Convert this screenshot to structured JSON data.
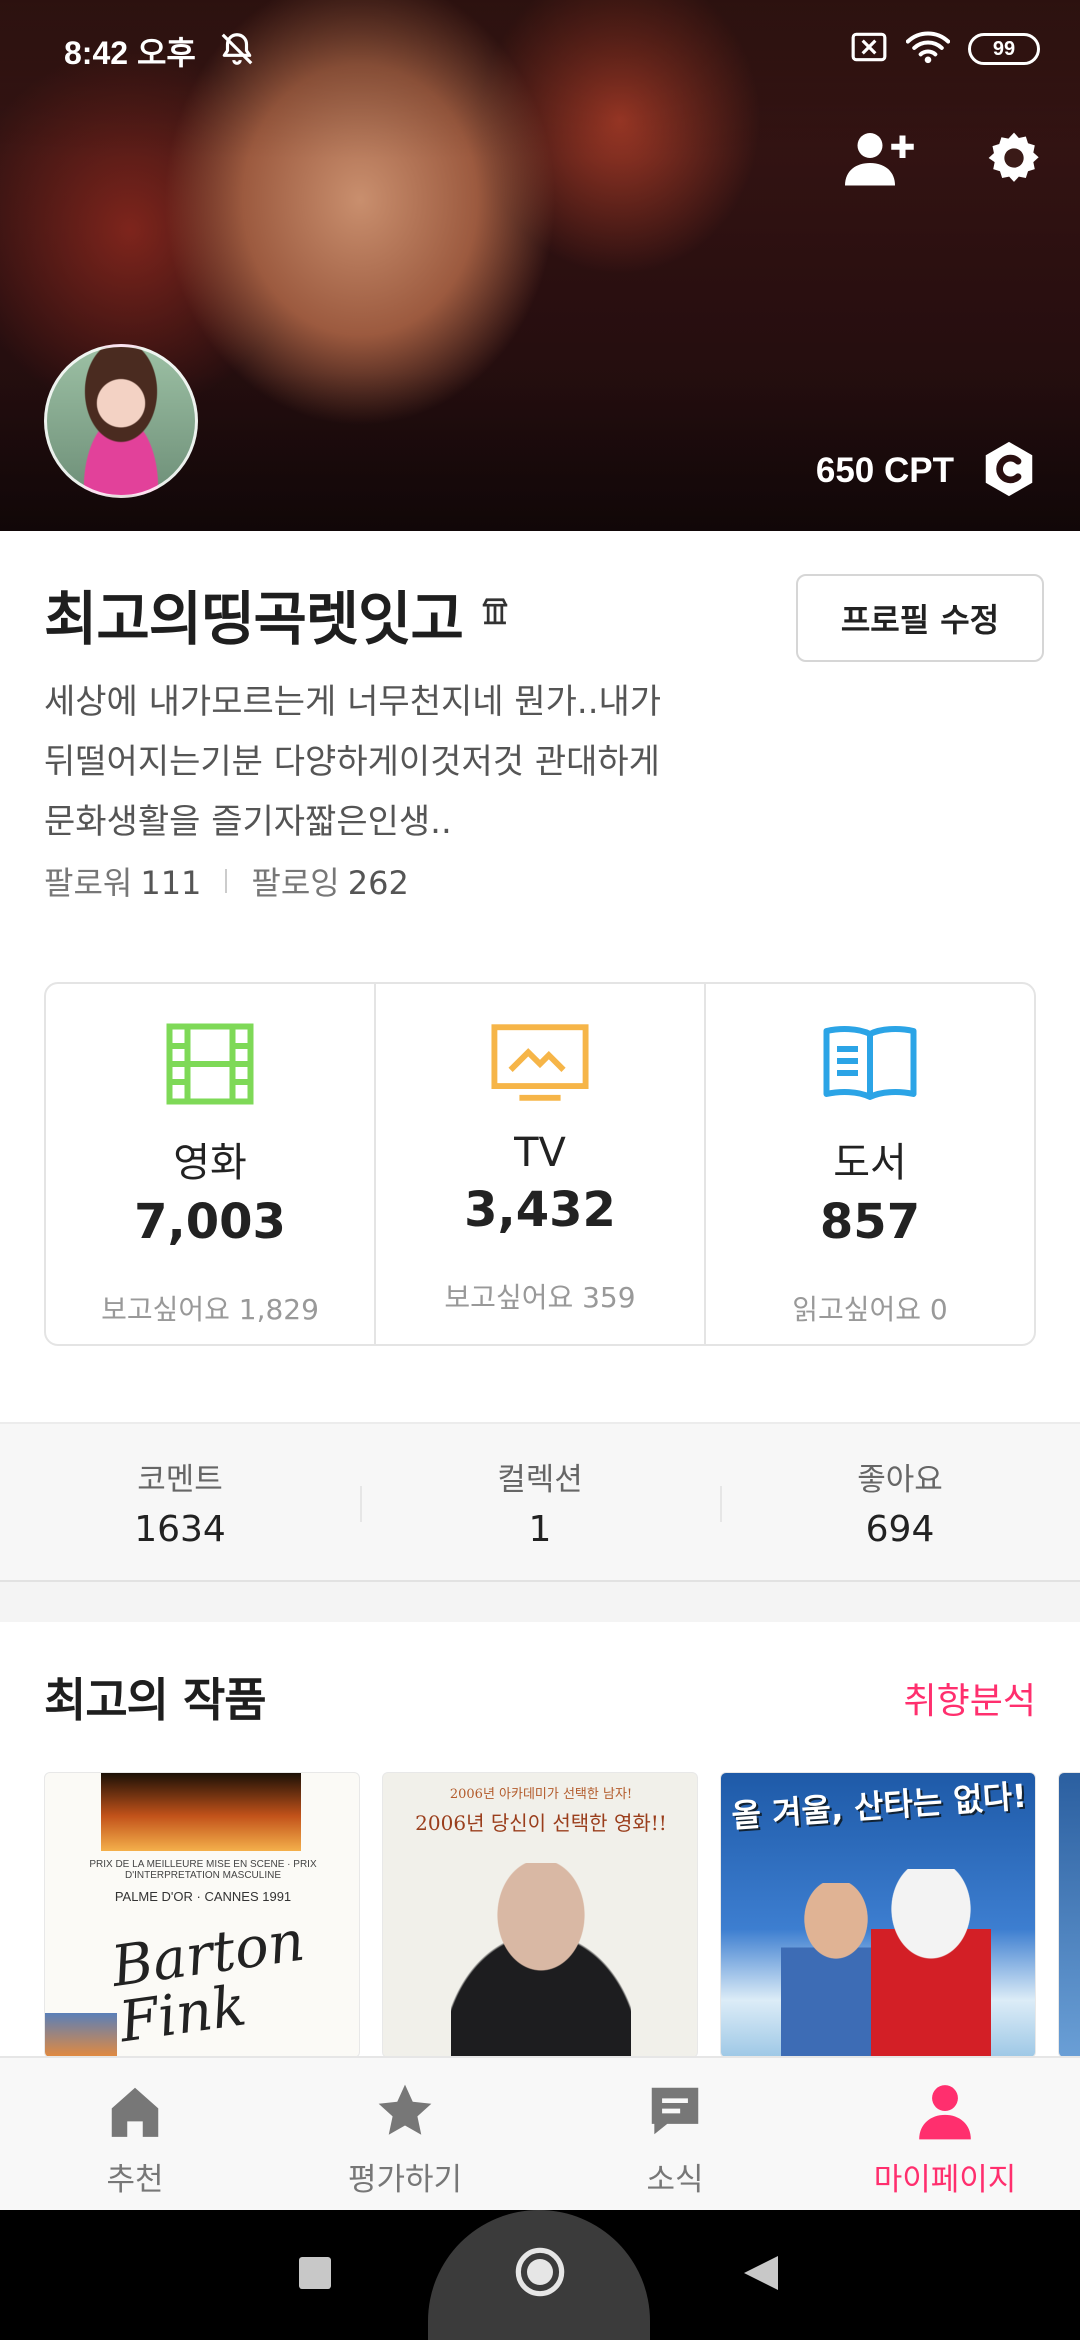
{
  "status_bar": {
    "time": "8:42 오후",
    "battery": "99"
  },
  "hero": {
    "cpt": "650 CPT"
  },
  "profile": {
    "name": "최고의띵곡렛잇고",
    "edit_button": "프로필 수정",
    "bio_lines": [
      "세상에 내가모르는게 너무천지네 뭔가..내가",
      "뒤떨어지는기분 다양하게이것저것 관대하게",
      "문화생활을 즐기자짧은인생.."
    ],
    "followers_label": "팔로워",
    "followers": "111",
    "following_label": "팔로잉",
    "following": "262"
  },
  "categories": [
    {
      "label": "영화",
      "count": "7,003",
      "sub": "보고싶어요 1,829",
      "icon": "film-icon",
      "color": "#7ed957"
    },
    {
      "label": "TV",
      "count": "3,432",
      "sub": "보고싶어요 359",
      "icon": "tv-icon",
      "color": "#f6b548"
    },
    {
      "label": "도서",
      "count": "857",
      "sub": "읽고싶어요 0",
      "icon": "book-icon",
      "color": "#2ba4e6"
    }
  ],
  "stats": [
    {
      "label": "코멘트",
      "value": "1634"
    },
    {
      "label": "컬렉션",
      "value": "1"
    },
    {
      "label": "좋아요",
      "value": "694"
    }
  ],
  "best": {
    "title": "최고의 작품",
    "link": "취향분석",
    "link_color": "#ff2f6e",
    "posters": [
      {
        "title_art": "Barton Fink",
        "small_text": "PRIX DE LA MEILLEURE MISE EN SCENE · PRIX D'INTERPRETATION MASCULINE",
        "award": "PALME D'OR · CANNES 1991"
      },
      {
        "top_text": "2006년 아카데미가 선택한 남자!",
        "headline": "2006년 당신이 선택한 영화!!"
      },
      {
        "headline": "올 겨울, 산타는 없다!"
      }
    ]
  },
  "bottom_nav": [
    {
      "label": "추천",
      "icon": "home-icon",
      "active": false
    },
    {
      "label": "평가하기",
      "icon": "star-icon",
      "active": false
    },
    {
      "label": "소식",
      "icon": "chat-icon",
      "active": false
    },
    {
      "label": "마이페이지",
      "icon": "person-icon",
      "active": true
    }
  ],
  "accent_color": "#ff2f6e"
}
